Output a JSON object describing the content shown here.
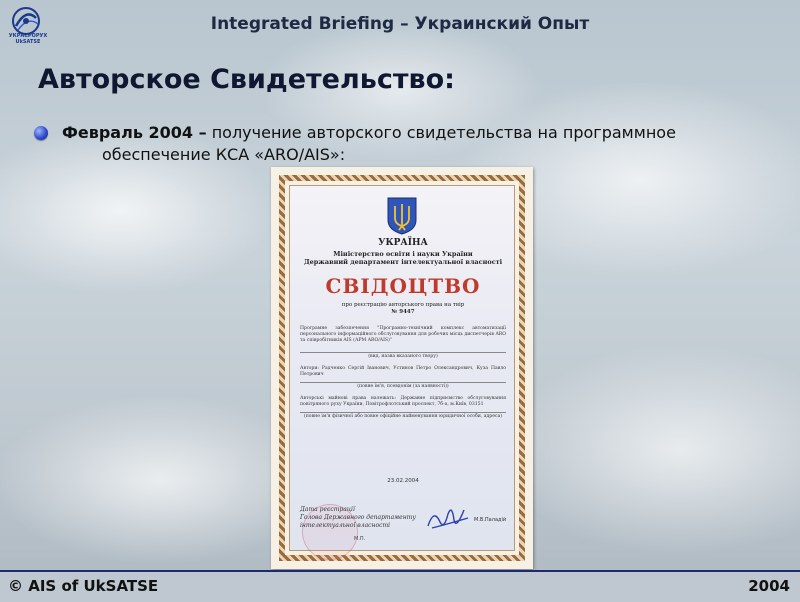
{
  "header": {
    "title": "Integrated Briefing – Украинский Опыт",
    "logo_text": "УКРАЄРОРУХ\nUkSATSE"
  },
  "slide": {
    "title": "Авторское Свидетельство:",
    "bullet": {
      "lead": "Февраль 2004 –",
      "line1": " получение авторского свидетельства на программное",
      "line2": "обеспечение КСА «ARO/AIS»:"
    }
  },
  "certificate": {
    "country": "УКРАЇНА",
    "ministry_line1": "Міністерство освіти і науки України",
    "ministry_line2": "Державний департамент інтелектуальної власності",
    "heading": "СВІДОЦТВО",
    "subtitle": "про реєстрацію авторського права на твір",
    "number": "№ 9447",
    "work_text": "Програмне забезпечення \"Програмно-технічний комплекс автоматизації персонального інформаційного обслуговування для робочих місць диспетчерів ARO та співробітників AIS (АРМ ARO/AIS)\"",
    "work_caption": "(вид, назва вказаного твору)",
    "authors_text": "Автори: Радченко Сергій Іванович, Устинов Петро Олександрович, Куза Павло Петрович",
    "authors_caption": "(повне ім'я, псевдонім (за наявності))",
    "owner_text": "Авторські майнові права належать: Державне підприємство обслуговування повітряного руху України, Повітрофлотський проспект, 7б-а, м.Київ, 03151",
    "owner_caption": "(повне ім'я фізичної або повне офіційне найменування юридичної особи, адреса)",
    "date": "23.02.2004",
    "sign_label1": "Дата реєстрації",
    "sign_label2": "Голова Державного департаменту",
    "sign_label3": "інтелектуальної власності",
    "signer": "М.В.Паладій",
    "seal_label": "М.П."
  },
  "footer": {
    "left": "© AIS of UkSATSE",
    "right": "2004"
  },
  "colors": {
    "title_text": "#0f1830",
    "bullet_accent": "#2a46c8",
    "cert_heading": "#c03a2b",
    "footer_bg": "#bfc8d0"
  }
}
